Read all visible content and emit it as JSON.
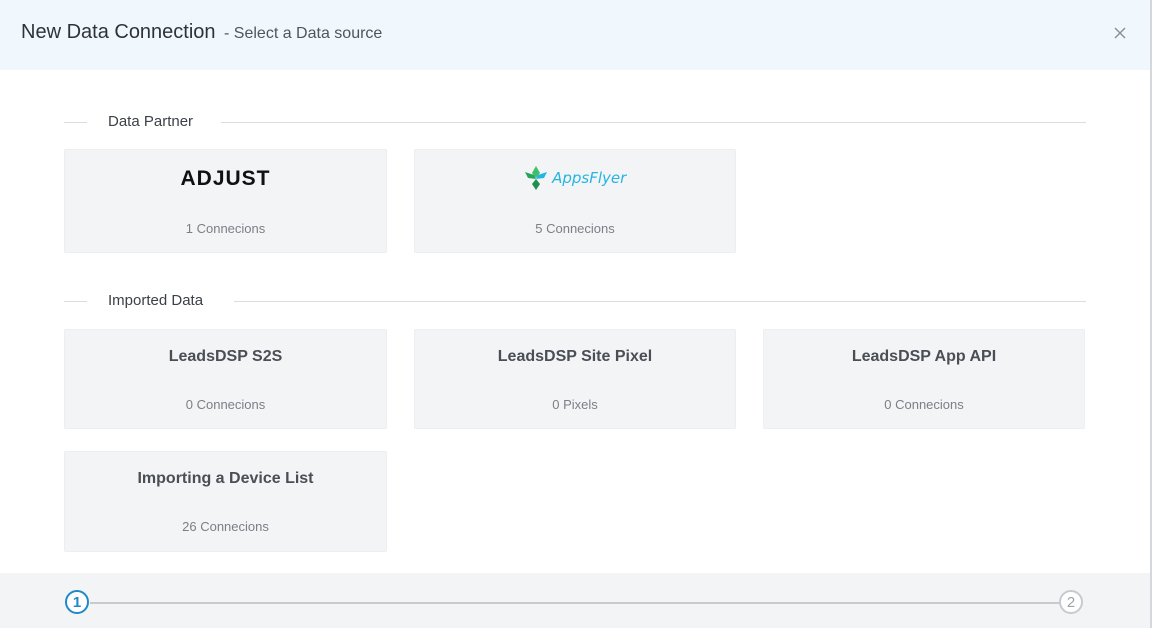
{
  "header": {
    "title": "New Data Connection",
    "subtitle": "- Select a Data source",
    "close_icon": "close-icon"
  },
  "sections": {
    "partner": {
      "label": "Data Partner",
      "cards": [
        {
          "name": "ADJUST",
          "logo": "adjust-logo",
          "count": "1 Connecions"
        },
        {
          "name": "AppsFlyer",
          "logo": "appsflyer-logo",
          "count": "5 Connecions"
        }
      ]
    },
    "imported": {
      "label": "Imported Data",
      "cards": [
        {
          "title": "LeadsDSP S2S",
          "count": "0 Connecions"
        },
        {
          "title": "LeadsDSP Site Pixel",
          "count": "0 Pixels"
        },
        {
          "title": "LeadsDSP App API",
          "count": "0 Connecions"
        },
        {
          "title": "Importing a Device List",
          "count": "26 Connecions"
        }
      ]
    }
  },
  "stepper": {
    "steps": [
      {
        "number": "1",
        "state": "active"
      },
      {
        "number": "2",
        "state": "inactive"
      }
    ]
  },
  "colors": {
    "header_bg": "#f0f8fd",
    "card_bg": "#f3f4f6",
    "accent": "#1e88c8",
    "appsflyer_blue": "#25b5e2",
    "appsflyer_green": "#3dbf6b"
  }
}
